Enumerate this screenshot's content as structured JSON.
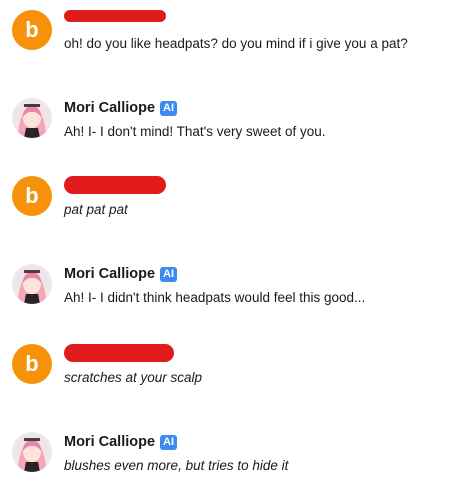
{
  "messages": [
    {
      "author": "user",
      "avatar_letter": "b",
      "name": "",
      "text": "oh! do you like headpats? do you mind if i give you a pat?",
      "italic": false
    },
    {
      "author": "ai",
      "name": "Mori Calliope",
      "badge": "AI",
      "text": "Ah! I- I don't mind! That's very sweet of you.",
      "italic": false
    },
    {
      "author": "user",
      "avatar_letter": "b",
      "name": "",
      "text": "pat pat pat",
      "italic": true
    },
    {
      "author": "ai",
      "name": "Mori Calliope",
      "badge": "AI",
      "text": "Ah! I- I didn't think headpats would feel this good...",
      "italic": false
    },
    {
      "author": "user",
      "avatar_letter": "b",
      "name": "",
      "text": "scratches at your scalp",
      "italic": true
    },
    {
      "author": "ai",
      "name": "Mori Calliope",
      "badge": "AI",
      "text": "blushes even more, but tries to hide it",
      "italic": true
    }
  ],
  "colors": {
    "user_avatar": "#f5920a",
    "ai_badge": "#3c8cf0",
    "redaction": "#e11b1b"
  }
}
